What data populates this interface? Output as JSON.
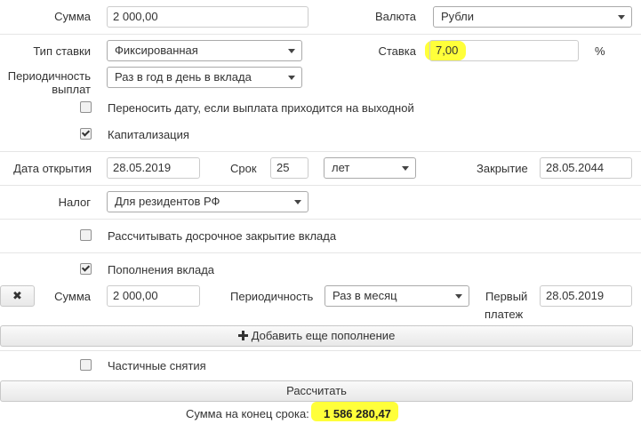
{
  "row1": {
    "sum_label": "Сумма",
    "sum_value": "2 000,00",
    "currency_label": "Валюта",
    "currency_value": "Рубли"
  },
  "row2": {
    "rate_type_label": "Тип ставки",
    "rate_type_value": "Фиксированная",
    "rate_label": "Ставка",
    "rate_value": "7,00",
    "percent": "%"
  },
  "row3": {
    "periodicity_label_1": "Периодичность",
    "periodicity_label_2": "выплат",
    "periodicity_value": "Раз в год в день в вклада"
  },
  "checks": {
    "move_date": {
      "label": "Переносить дату, если выплата приходится на выходной",
      "checked": false
    },
    "capitalization": {
      "label": "Капитализация",
      "checked": true
    },
    "early_close": {
      "label": "Рассчитывать досрочное закрытие вклада",
      "checked": false
    },
    "refill": {
      "label": "Пополнения вклада",
      "checked": true
    },
    "partial": {
      "label": "Частичные снятия",
      "checked": false
    }
  },
  "dates": {
    "open_label": "Дата открытия",
    "open_value": "28.05.2019",
    "term_label": "Срок",
    "term_value": "25",
    "term_unit": "лет",
    "close_label": "Закрытие",
    "close_value": "28.05.2044"
  },
  "tax": {
    "label": "Налог",
    "value": "Для резидентов РФ"
  },
  "refill_row": {
    "remove_icon": "✖",
    "sum_label": "Сумма",
    "sum_value": "2 000,00",
    "periodicity_label": "Периодичность",
    "periodicity_value": "Раз в месяц",
    "first_label_1": "Первый",
    "first_label_2": "платеж",
    "first_value": "28.05.2019"
  },
  "add_refill_label": "Добавить еще пополнение",
  "calculate_label": "Рассчитать",
  "result": {
    "label": "Сумма на конец срока:",
    "value": "1 586 280,47"
  },
  "colors": {
    "highlight": "#ffff3a",
    "border": "#cccccc"
  }
}
